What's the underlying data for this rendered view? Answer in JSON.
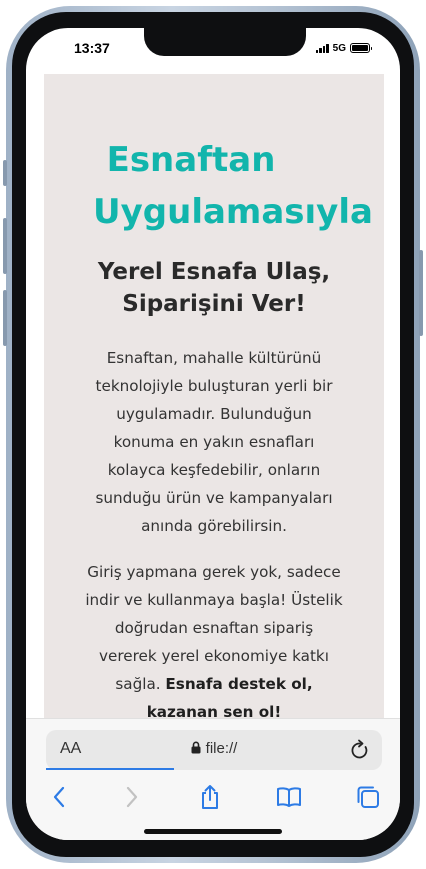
{
  "status_bar": {
    "time": "13:37",
    "network": "5G"
  },
  "page": {
    "title_line1": "Esnaftan",
    "title_line2": "Uygulamasıyla",
    "title_color": "#12b5ac",
    "subtitle": "Yerel Esnafa Ulaş, Siparişini Ver!",
    "paragraph1": "Esnaftan, mahalle kültürünü teknolojiyle buluşturan yerli bir uygulamadır. Bulunduğun konuma en yakın esnafları kolayca keşfedebilir, onların sunduğu ürün ve kampanyaları anında görebilirsin.",
    "paragraph2_text": "Giriş yapmana gerek yok, sadece indir ve kullanmaya başla! Üstelik doğrudan esnaftan sipariş vererek yerel ekonomiye katkı sağla. ",
    "paragraph2_bold": "Esnafa destek ol, kazanan sen ol!",
    "background_color": "#ebe6e5"
  },
  "safari": {
    "text_size_label": "AA",
    "url": "file://",
    "load_progress": 0.38,
    "accent_color": "#2d7be5",
    "icons": [
      "lock-icon",
      "reload-icon",
      "back-icon",
      "forward-icon",
      "share-icon",
      "bookmarks-icon",
      "tabs-icon"
    ]
  }
}
